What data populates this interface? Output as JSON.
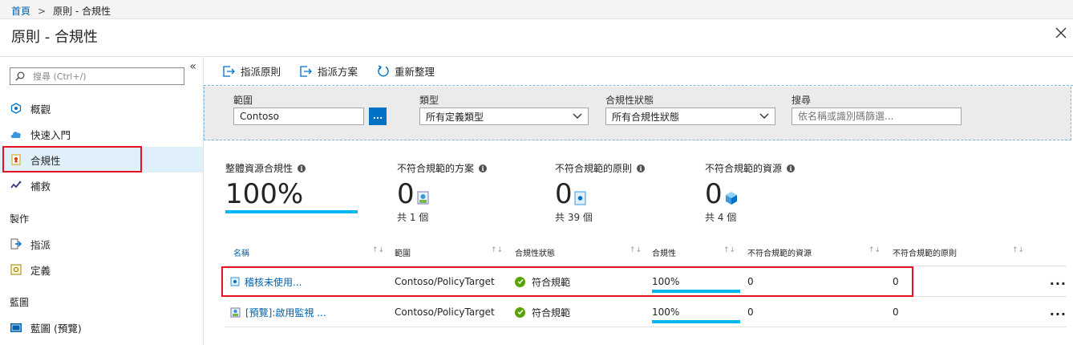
{
  "breadcrumb": {
    "home": "首頁",
    "current": "原則 - 合規性"
  },
  "header": {
    "title": "原則 - 合規性"
  },
  "sidebar": {
    "search_placeholder": "搜尋 (Ctrl+/)",
    "items": [
      {
        "label": "概觀",
        "icon": "overview-icon"
      },
      {
        "label": "快速入門",
        "icon": "cloud-icon"
      },
      {
        "label": "合規性",
        "icon": "compliance-icon"
      },
      {
        "label": "補救",
        "icon": "remediation-icon"
      }
    ],
    "section_authoring": "製作",
    "authoring_items": [
      {
        "label": "指派",
        "icon": "assign-icon"
      },
      {
        "label": "定義",
        "icon": "definition-icon"
      }
    ],
    "section_blueprints": "藍圖",
    "blueprint_items": [
      {
        "label": "藍圖 (預覽)",
        "icon": "blueprint-icon"
      }
    ]
  },
  "toolbar": {
    "assign_policy": "指派原則",
    "assign_initiative": "指派方案",
    "refresh": "重新整理"
  },
  "filters": {
    "scope_label": "範圍",
    "scope_value": "Contoso",
    "scope_button": "...",
    "type_label": "類型",
    "type_value": "所有定義類型",
    "state_label": "合規性狀態",
    "state_value": "所有合規性狀態",
    "search_label": "搜尋",
    "search_placeholder": "依名稱或識別碼篩選..."
  },
  "stats": {
    "overall_label": "整體資源合規性",
    "overall_value": "100%",
    "overall_fraction": 1.0,
    "initiatives_label": "不符合規範的方案",
    "initiatives_value": "0",
    "initiatives_sub": "共 1 個",
    "policies_label": "不符合規範的原則",
    "policies_value": "0",
    "policies_sub": "共 39 個",
    "resources_label": "不符合規範的資源",
    "resources_value": "0",
    "resources_sub": "共 4 個"
  },
  "table": {
    "columns": [
      "名稱",
      "範圍",
      "合規性狀態",
      "合規性",
      "不符合規範的資源",
      "不符合規範的原則"
    ],
    "rows": [
      {
        "name": "稽核未使用...",
        "scope": "Contoso/PolicyTarget",
        "state": "符合規範",
        "compliance": "100%",
        "noncompliant_resources": "0",
        "noncompliant_policies": "0",
        "menu": "..."
      },
      {
        "name": "[預覽]:啟用監視 ...",
        "scope": "Contoso/PolicyTarget",
        "state": "符合規範",
        "compliance": "100%",
        "noncompliant_resources": "0",
        "noncompliant_policies": "0",
        "menu": "..."
      }
    ]
  },
  "colors": {
    "accent": "#0072c6",
    "bar": "#00b7f0",
    "highlight": "#e81123",
    "compliant": "#57a300"
  }
}
